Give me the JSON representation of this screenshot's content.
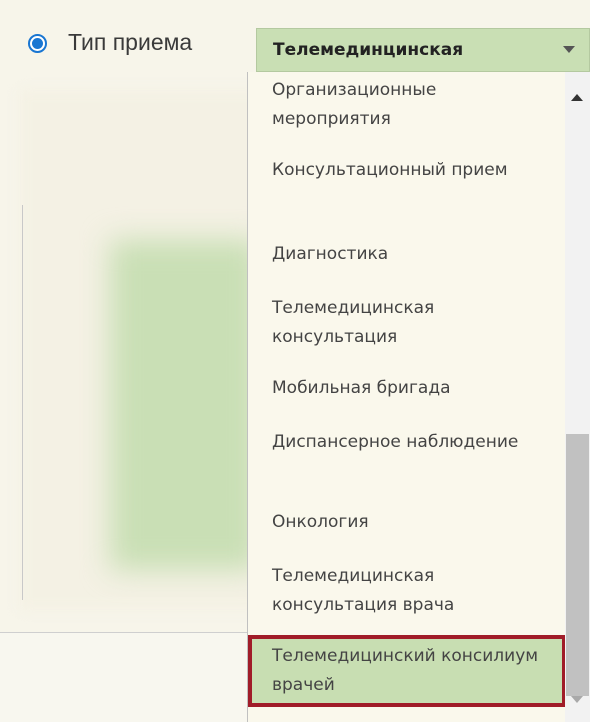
{
  "field": {
    "label": "Тип приема",
    "selected_value": "Телемединцинская"
  },
  "dropdown": {
    "items": [
      {
        "label": "Организационные мероприятия"
      },
      {
        "label": "Консультационный прием"
      },
      {
        "label": "Диагностика"
      },
      {
        "label": "Телемедицинская консультация"
      },
      {
        "label": "Мобильная бригада"
      },
      {
        "label": "Диспансерное наблюдение"
      },
      {
        "label": "Онкология"
      },
      {
        "label": "Телемедицинская консультация врача"
      },
      {
        "label": "Телемедицинский консилиум врачей",
        "highlighted": true
      }
    ]
  },
  "colors": {
    "radio_accent": "#1976d2",
    "select_bg": "#c9dfb4",
    "highlight_border": "#a01c28"
  }
}
